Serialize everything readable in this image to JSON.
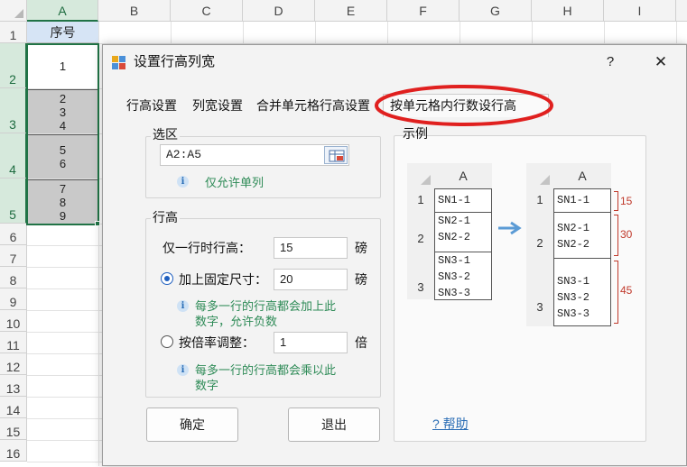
{
  "sheet": {
    "columns": [
      "A",
      "B",
      "C",
      "D",
      "E",
      "F",
      "G",
      "H",
      "I"
    ],
    "rows": [
      "1",
      "2",
      "3",
      "4",
      "5",
      "6",
      "7",
      "8",
      "9",
      "10",
      "11",
      "12",
      "13",
      "14",
      "15",
      "16"
    ],
    "cells": {
      "a1": "序号",
      "a2": "1",
      "a3": [
        "2",
        "3",
        "4"
      ],
      "a4": [
        "5",
        "6"
      ],
      "a5": [
        "7",
        "8",
        "9"
      ]
    }
  },
  "dialog": {
    "title": "设置行高列宽",
    "help_label": "?",
    "close_label": "✕",
    "tabs": [
      "行高设置",
      "列宽设置",
      "合并单元格行高设置",
      "按单元格内行数设行高"
    ],
    "selection": {
      "group_label": "选区",
      "range_value": "A2:A5",
      "hint": "仅允许单列"
    },
    "row_height": {
      "group_label": "行高",
      "single_label": "仅一行时行高：",
      "single_value": "15",
      "single_unit": "磅",
      "fixed_label": "加上固定尺寸：",
      "fixed_value": "20",
      "fixed_unit": "磅",
      "fixed_checked": true,
      "fixed_hint_1": "每多一行的行高都会加上此",
      "fixed_hint_2": "数字，允许负数",
      "ratio_label": "按倍率调整：",
      "ratio_value": "1",
      "ratio_unit": "倍",
      "ratio_checked": false,
      "ratio_hint_1": "每多一行的行高都会乘以此",
      "ratio_hint_2": "数字"
    },
    "buttons": {
      "ok": "确定",
      "exit": "退出"
    },
    "example": {
      "label": "示例",
      "col_header": "A",
      "before": {
        "rows": [
          "1",
          "2",
          "3"
        ],
        "cells": [
          [
            "SN1-1"
          ],
          [
            "SN2-1",
            "SN2-2"
          ],
          [
            "SN3-1",
            "SN3-2",
            "SN3-3"
          ]
        ]
      },
      "after": {
        "rows": [
          "1",
          "2",
          "3"
        ],
        "cells": [
          [
            "SN1-1"
          ],
          [
            "SN2-1",
            "SN2-2"
          ],
          [
            "SN3-1",
            "SN3-2",
            "SN3-3"
          ]
        ],
        "heights": [
          "15",
          "30",
          "45"
        ]
      },
      "help_link": "? 帮助"
    },
    "colors": {
      "accent": "#217346",
      "highlight_oval": "#e0201f",
      "hint_text": "#2e8b57",
      "brace": "#c0392b",
      "arrow": "#5b9bd5"
    }
  }
}
